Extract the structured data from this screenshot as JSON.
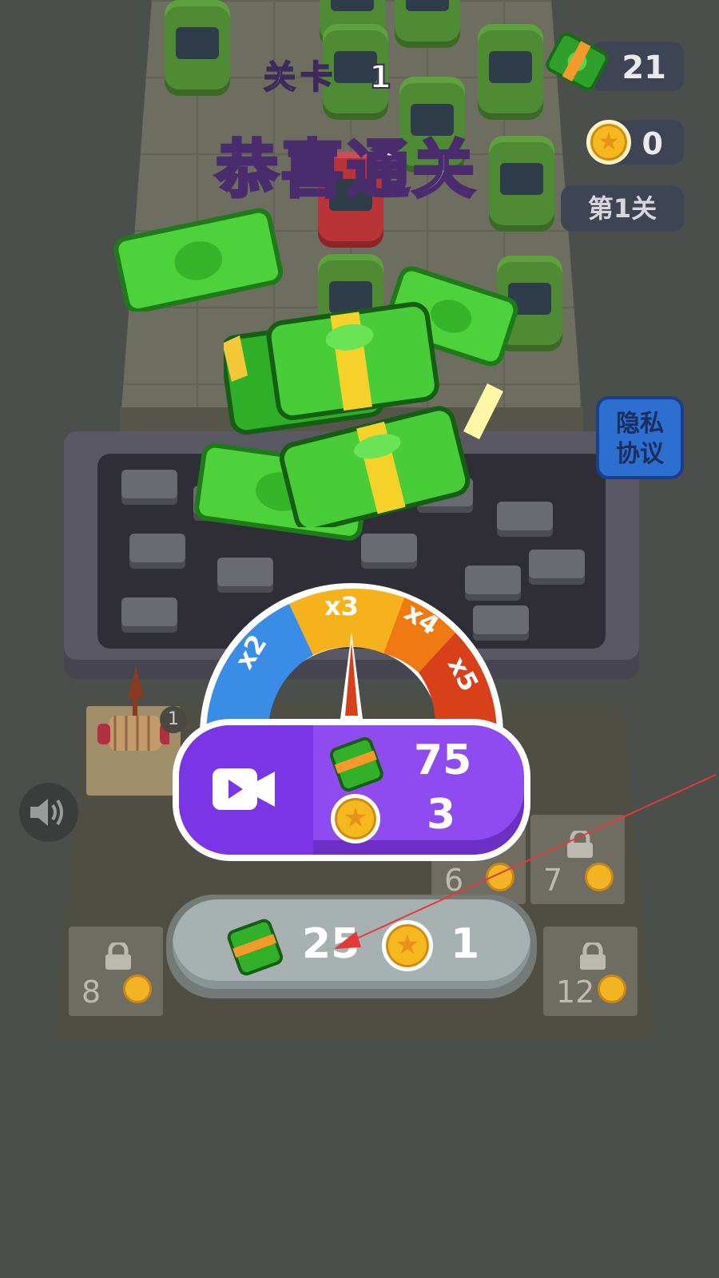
{
  "level": {
    "label": "关卡",
    "number": "1"
  },
  "win_text": "恭喜通关",
  "hud": {
    "cash_count": "21",
    "coin_count": "0",
    "level_tag": "第1关"
  },
  "privacy_button": {
    "line1": "隐私",
    "line2": "协议"
  },
  "multiplier_gauge": {
    "segments": [
      "x2",
      "x3",
      "x4",
      "x5"
    ]
  },
  "reward_video_button": {
    "cash_value": "75",
    "coin_value": "3",
    "icon": "video-icon"
  },
  "collect_button": {
    "cash_value": "25",
    "coin_value": "1"
  },
  "slots": {
    "active_badge_1": "1",
    "numbers": [
      "6",
      "7",
      "8",
      "12"
    ]
  },
  "colors": {
    "gauge_blue": "#3a8de6",
    "gauge_yellow": "#f6b21c",
    "gauge_orange": "#f07a12",
    "gauge_red": "#d8401a",
    "reward_purple": "#8e4cf0"
  }
}
